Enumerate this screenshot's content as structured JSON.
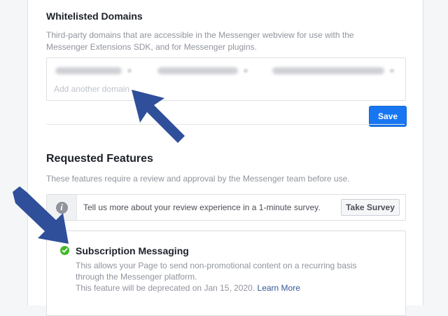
{
  "whitelist": {
    "title": "Whitelisted Domains",
    "description": "Third-party domains that are accessible in the Messenger webview for use with the Messenger Extensions SDK, and for Messenger plugins.",
    "input_placeholder": "Add another domain",
    "save_label": "Save"
  },
  "requested": {
    "title": "Requested Features",
    "description": "These features require a review and approval by the Messenger team before use.",
    "survey_text": "Tell us more about your review experience in a 1-minute survey.",
    "survey_button": "Take Survey"
  },
  "feature": {
    "title": "Subscription Messaging",
    "description": "This allows your Page to send non-promotional content on a recurring basis through the Messenger platform.",
    "deprecation": "This feature will be deprecated on Jan 15, 2020.",
    "learn_more": "Learn More",
    "status_color": "#42b72a"
  },
  "colors": {
    "accent": "#1876f2",
    "arrow": "#2f4f9a"
  }
}
